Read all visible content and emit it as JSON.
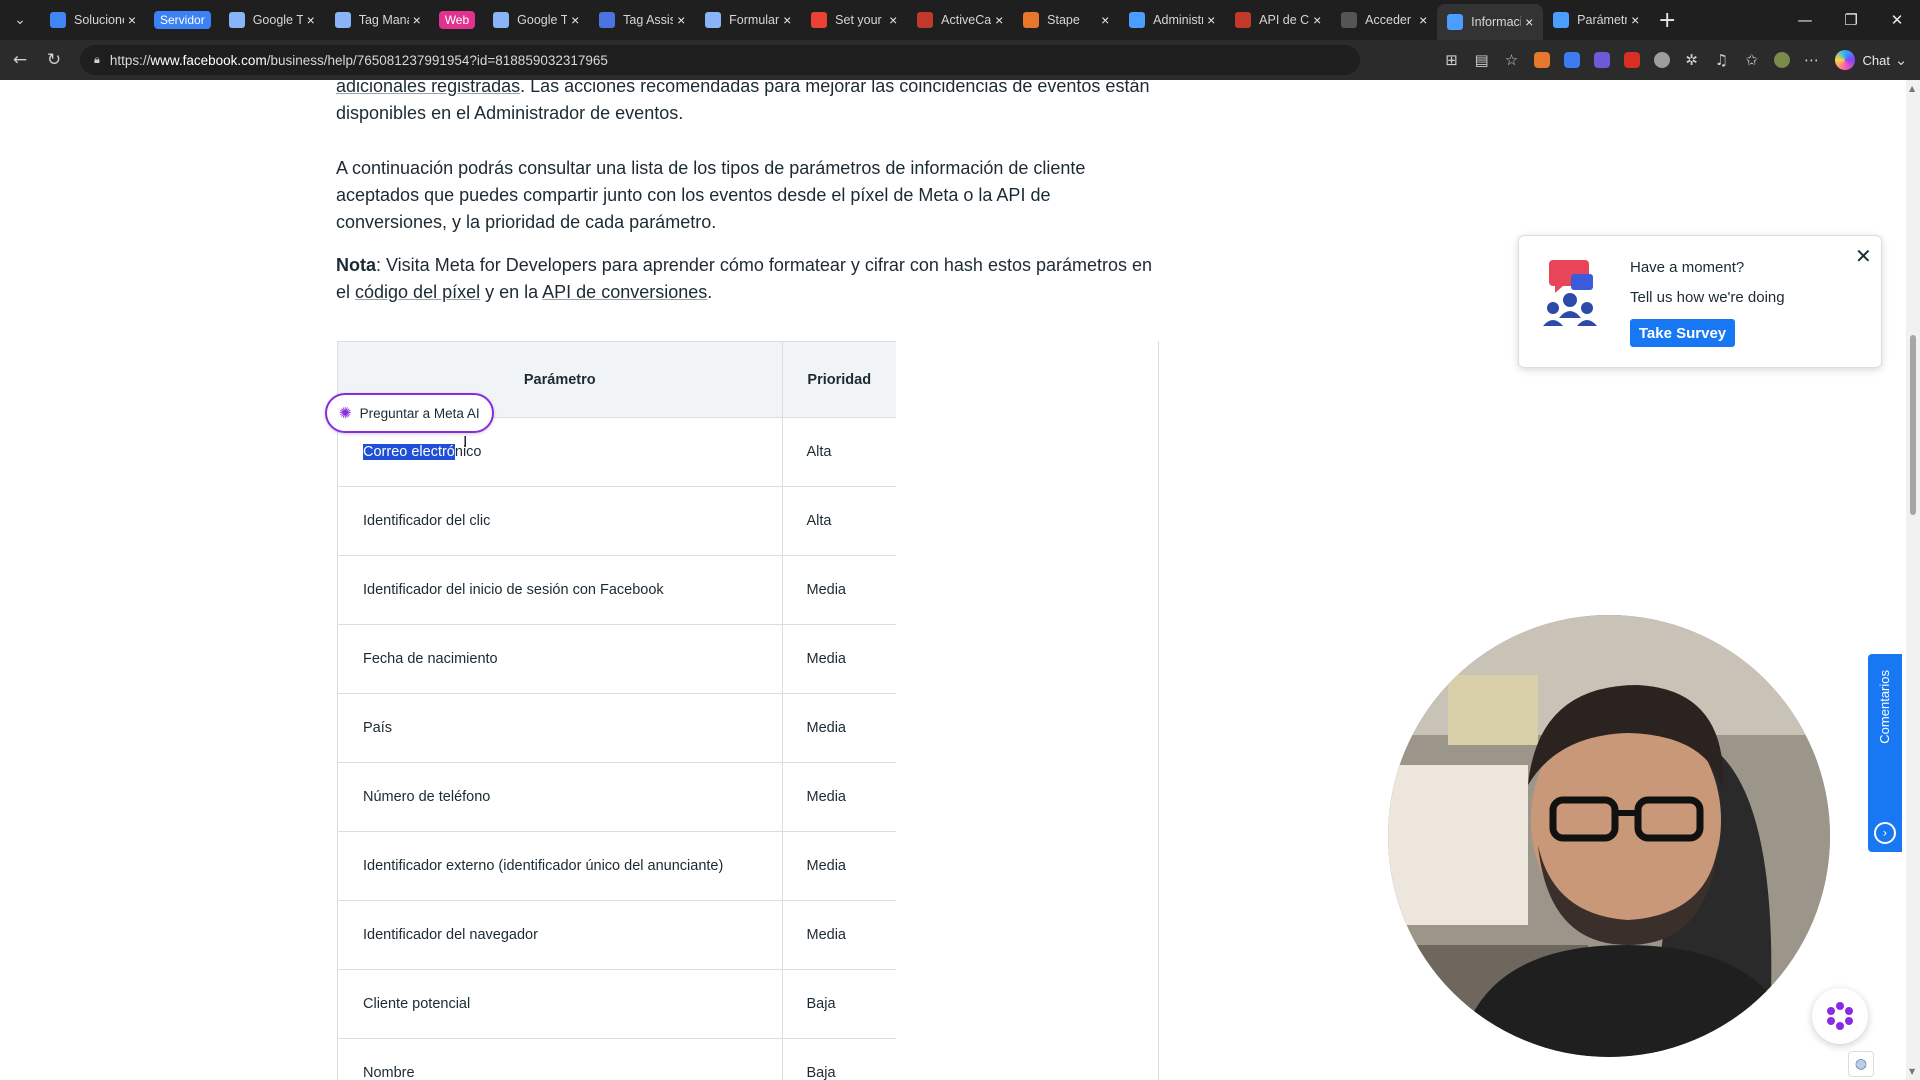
{
  "tabs": [
    {
      "label": "Solucione",
      "icon": "google-icon",
      "color": "#4285f4"
    },
    {
      "label": "Servidor",
      "icon": "tag-group-pill",
      "color": "#3b82f6",
      "pill": true
    },
    {
      "label": "Google Ta",
      "icon": "tag-manager-icon",
      "color": "#8ab4f8"
    },
    {
      "label": "Tag Mana",
      "icon": "tag-manager-icon",
      "color": "#8ab4f8"
    },
    {
      "label": "Web",
      "icon": "tag-group-pill",
      "color": "#e0338f",
      "pill": true
    },
    {
      "label": "Google Ta",
      "icon": "tag-manager-icon",
      "color": "#8ab4f8"
    },
    {
      "label": "Tag Assist",
      "icon": "tag-assistant-icon",
      "color": "#4b74e0"
    },
    {
      "label": "Formulari",
      "icon": "form-icon",
      "color": "#8ab4f8"
    },
    {
      "label": "Set your p",
      "icon": "gmail-icon",
      "color": "#ea4335"
    },
    {
      "label": "ActiveCam",
      "icon": "tp-icon",
      "color": "#c0392b"
    },
    {
      "label": "Stape",
      "icon": "stape-icon",
      "color": "#e8772e"
    },
    {
      "label": "Administr",
      "icon": "meta-icon",
      "color": "#4b9dff"
    },
    {
      "label": "API de Co",
      "icon": "tp-icon",
      "color": "#c0392b"
    },
    {
      "label": "Acceder",
      "icon": "blank-icon",
      "color": "#555555"
    },
    {
      "label": "Informaci",
      "icon": "meta-icon",
      "color": "#4b9dff",
      "active": true
    },
    {
      "label": "Parámetro",
      "icon": "meta-icon",
      "color": "#4b9dff"
    }
  ],
  "address": {
    "prefix": "https://",
    "host": "www.facebook.com",
    "path": "/business/help/765081237991954?id=818859032317965"
  },
  "toolbar": {
    "chat_label": "Chat"
  },
  "article": {
    "para1_link": "adicionales registradas",
    "para1_rest": ". Las acciones recomendadas para mejorar las coincidencias de eventos están disponibles en el Administrador de eventos.",
    "para2": "A continuación podrás consultar una lista de los tipos de parámetros de información de cliente aceptados que puedes compartir junto con los eventos desde el píxel de Meta o la API de conversiones, y la prioridad de cada parámetro.",
    "para3_bold": "Nota",
    "para3_a": ": Visita Meta for Developers para aprender cómo formatear y cifrar con hash estos parámetros en el ",
    "para3_link1": "código del píxel",
    "para3_b": " y en la ",
    "para3_link2": "API de conversiones",
    "para3_c": "."
  },
  "table": {
    "headers": [
      "Parámetro",
      "Prioridad"
    ],
    "rows": [
      {
        "param_selected": "Correo electró",
        "param_rest": "nico",
        "priority": "Alta"
      },
      {
        "param": "Identificador del clic",
        "priority": "Alta"
      },
      {
        "param": "Identificador del inicio de sesión con Facebook",
        "priority": "Media"
      },
      {
        "param": "Fecha de nacimiento",
        "priority": "Media"
      },
      {
        "param": "País",
        "priority": "Media"
      },
      {
        "param": "Número de teléfono",
        "priority": "Media"
      },
      {
        "param": "Identificador externo (identificador único del anunciante)",
        "priority": "Media"
      },
      {
        "param": "Identificador del navegador",
        "priority": "Media"
      },
      {
        "param": "Cliente potencial",
        "priority": "Baja"
      },
      {
        "param": "Nombre",
        "priority": "Baja"
      }
    ]
  },
  "meta_ai_popup": {
    "label": "Preguntar a Meta AI"
  },
  "survey": {
    "title": "Have a moment?",
    "subtitle": "Tell us how we're doing",
    "button": "Take Survey"
  },
  "feedback_tab": {
    "label": "Comentarios"
  },
  "colors": {
    "accent": "#1877f2",
    "selection": "#1e4fd6",
    "meta_ai_purple": "#8a2be2"
  }
}
